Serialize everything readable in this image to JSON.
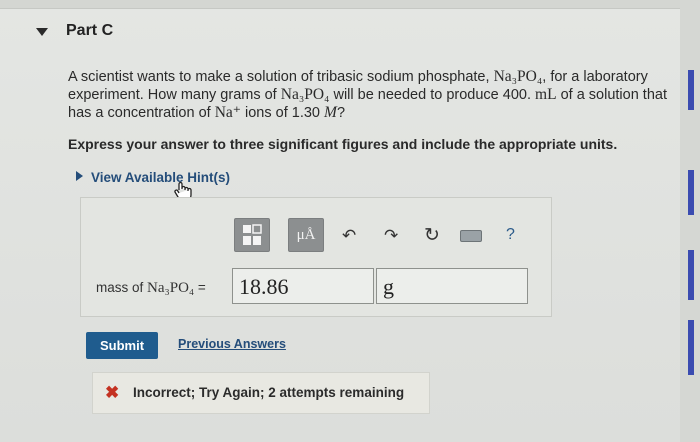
{
  "part": {
    "title": "Part C"
  },
  "question": {
    "line1_a": "A scientist wants to make a solution of tribasic sodium phosphate, ",
    "line1_chem": "Na₃PO₄",
    "line1_b": ", for a laboratory",
    "line2_a": "experiment. How many grams of ",
    "line2_chem": "Na₃PO₄",
    "line2_b": " will be needed to produce 400. ",
    "line2_unit": "mL",
    "line2_c": " of a solution that",
    "line3_a": "has a concentration of ",
    "line3_ion": "Na⁺",
    "line3_b": " ions of 1.30 ",
    "line3_m": "M",
    "line3_c": "?"
  },
  "instruction": "Express your answer to three significant figures and include the appropriate units.",
  "hints_label": "View Available Hint(s)",
  "toolbar": {
    "units_label": "μÅ",
    "undo": "↶",
    "redo": "↷",
    "reset": "↻",
    "help": "?"
  },
  "answer": {
    "label_prefix": "mass of ",
    "label_chem": "Na₃PO₄",
    "label_suffix": " =",
    "value": "18.86",
    "unit": "g"
  },
  "submit_label": "Submit",
  "previous_answers_label": "Previous Answers",
  "feedback": {
    "icon": "✖",
    "message": "Incorrect; Try Again; 2 attempts remaining"
  },
  "colors": {
    "link": "#244d7a",
    "submit": "#1f5c8e",
    "error": "#c43222"
  }
}
